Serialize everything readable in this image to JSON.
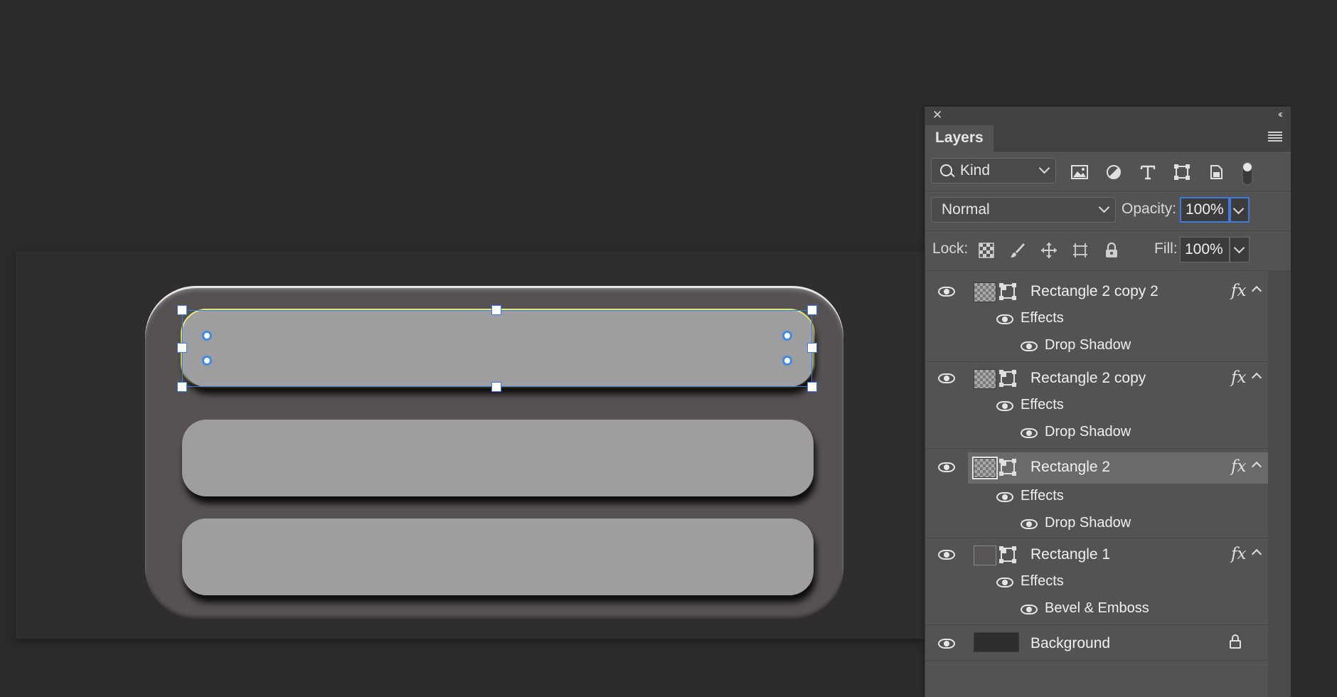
{
  "panel": {
    "title": "Layers",
    "close_icon": "close-icon",
    "collapse_glyph": "‹‹",
    "kind_label": "Kind",
    "blend_mode": "Normal",
    "opacity_label": "Opacity:",
    "opacity_value": "100%",
    "lock_label": "Lock:",
    "fill_label": "Fill:",
    "fill_value": "100%"
  },
  "layers": [
    {
      "name": "Rectangle 2 copy 2",
      "fx": "fx",
      "effects_label": "Effects",
      "effect": "Drop Shadow",
      "active": false
    },
    {
      "name": "Rectangle 2 copy",
      "fx": "fx",
      "effects_label": "Effects",
      "effect": "Drop Shadow",
      "active": false
    },
    {
      "name": "Rectangle 2",
      "fx": "fx",
      "effects_label": "Effects",
      "effect": "Drop Shadow",
      "active": true
    },
    {
      "name": "Rectangle 1",
      "fx": "fx",
      "effects_label": "Effects",
      "effect": "Bevel & Emboss",
      "active": false
    },
    {
      "name": "Background",
      "locked": true
    }
  ],
  "colors": {
    "app_bg": "#2b2b2b",
    "panel_bg": "#535353",
    "selection": "#3f7ad8",
    "shape_outer": "#575151",
    "shape_bar": "#9e9d9f",
    "path_highlight": "#e4ea74"
  }
}
